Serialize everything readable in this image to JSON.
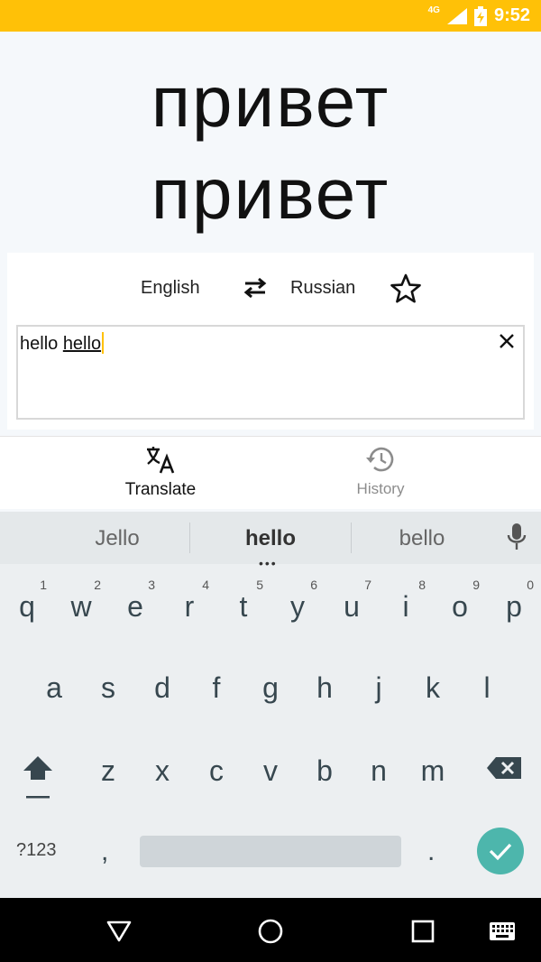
{
  "status_bar": {
    "network": "4G",
    "time": "9:52",
    "color": "#ffc107"
  },
  "translation": {
    "lines": [
      "привет",
      "привет"
    ]
  },
  "languages": {
    "source": "English",
    "target": "Russian",
    "swap_icon": "swap-arrows-icon",
    "favorite_icon": "star-outline-icon"
  },
  "input": {
    "prefix": "hello ",
    "underlined": "hello",
    "clear_icon": "close-icon"
  },
  "bottom_nav": {
    "translate_label": "Translate",
    "history_label": "History"
  },
  "keyboard": {
    "suggestions": [
      "Jello",
      "hello",
      "bello"
    ],
    "more_indicator": "•••",
    "row1": [
      {
        "ch": "q",
        "num": "1"
      },
      {
        "ch": "w",
        "num": "2"
      },
      {
        "ch": "e",
        "num": "3"
      },
      {
        "ch": "r",
        "num": "4"
      },
      {
        "ch": "t",
        "num": "5"
      },
      {
        "ch": "y",
        "num": "6"
      },
      {
        "ch": "u",
        "num": "7"
      },
      {
        "ch": "i",
        "num": "8"
      },
      {
        "ch": "o",
        "num": "9"
      },
      {
        "ch": "p",
        "num": "0"
      }
    ],
    "row2": [
      "a",
      "s",
      "d",
      "f",
      "g",
      "h",
      "j",
      "k",
      "l"
    ],
    "row3": [
      "z",
      "x",
      "c",
      "v",
      "b",
      "n",
      "m"
    ],
    "symbols_label": "?123",
    "comma": ",",
    "period": ".",
    "accent_color": "#4db6ac"
  }
}
